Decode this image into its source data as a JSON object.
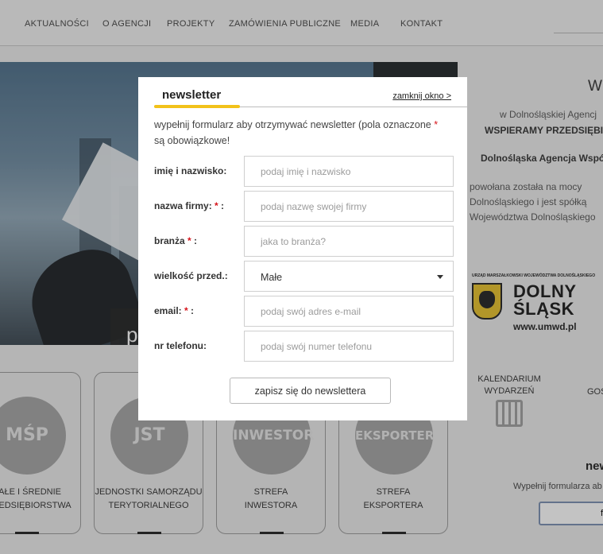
{
  "nav": {
    "items": [
      "AKTUALNOŚCI",
      "O AGENCJI",
      "PROJEKTY",
      "ZAMÓWIENIA PUBLICZNE",
      "MEDIA",
      "KONTAKT"
    ]
  },
  "hero": {
    "caption": "p"
  },
  "side": {
    "heading": "Wi",
    "line1": "w Dolnośląskiej Agencj",
    "line2": "WSPIERAMY PRZEDSIĘBIC",
    "line3": "Dolnośląska Agencja Współ",
    "line4": "powołana została na mocy",
    "line5": "Dolnośląskiego i jest spółką",
    "line6": "Województwa Dolnośląskiego"
  },
  "logo": {
    "top": "URZĄD MARSZAŁKOWSKI WOJEWÓDZTWA DOLNOŚLĄSKIEGO",
    "word1": "DOLNY",
    "word2": "ŚLĄSK",
    "url": "www.umwd.pl"
  },
  "tiles": [
    {
      "icon_text": "MŚP",
      "label1": "MAŁE I ŚREDNIE",
      "label2": "PRZEDSIĘBIORSTWA"
    },
    {
      "icon_text": "JST",
      "label1": "JEDNOSTKI SAMORZĄDU",
      "label2": "TERYTORIALNEGO"
    },
    {
      "icon_text": "INWESTOR",
      "label1": "STREFA",
      "label2": "INWESTORA"
    },
    {
      "icon_text": "EKSPORTER",
      "label1": "STREFA",
      "label2": "EKSPORTERA"
    }
  ],
  "calendar": {
    "label1": "KALENDARIUM",
    "label2": "WYDARZEŃ",
    "cut_label": "GOS"
  },
  "right_newsletter": {
    "title": "new",
    "subtitle": "Wypełnij formularza ab",
    "input_hint": "f"
  },
  "modal": {
    "title": "newsletter",
    "close": "zamknij okno >",
    "intro_a": "wypełnij formularz aby otrzymywać newsletter (pola oznaczone",
    "intro_star": "*",
    "intro_b": "są obowiązkowe!",
    "fields": [
      {
        "label": "imię i nazwisko:",
        "required": false,
        "placeholder": "podaj imię i nazwisko"
      },
      {
        "label": "nazwa firmy:",
        "required": true,
        "placeholder": "podaj nazwę swojej firmy"
      },
      {
        "label": "branża",
        "required": true,
        "placeholder": "jaka to branża?"
      },
      {
        "label": "wielkość przed.:",
        "required": false,
        "selected": "Małe"
      },
      {
        "label": "email:",
        "required": true,
        "placeholder": "podaj swój adres e-mail"
      },
      {
        "label": "nr telefonu:",
        "required": false,
        "placeholder": "podaj swój numer telefonu"
      }
    ],
    "required_marker": "*",
    "submit": "zapisz się do newslettera"
  }
}
